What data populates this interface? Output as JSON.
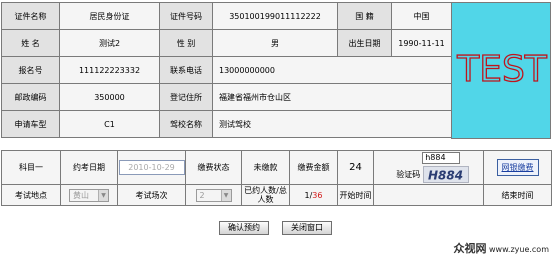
{
  "info": {
    "row1": {
      "id_label": "证件名称",
      "id_type": "居民身份证",
      "id_no_label": "证件号码",
      "id_no": "350100199011112222",
      "nationality_label": "国 籍",
      "nationality": "中国"
    },
    "row2": {
      "name_label": "姓 名",
      "name": "测试2",
      "gender_label": "性 别",
      "gender": "男",
      "birth_label": "出生日期",
      "birth": "1990-11-11"
    },
    "row3": {
      "reg_label": "报名号",
      "reg_no": "111122223332",
      "phone_label": "联系电话",
      "phone": "13000000000"
    },
    "row4": {
      "zip_label": "邮政编码",
      "zip": "350000",
      "addr_label": "登记住所",
      "addr": "福建省福州市仓山区"
    },
    "row5": {
      "cartype_label": "申请车型",
      "cartype": "C1",
      "school_label": "驾校名称",
      "school": "测试驾校"
    }
  },
  "photo": {
    "text": "TEST",
    "bg_color": "#51d6e8",
    "text_color": "#c0141c"
  },
  "exam": {
    "subject": "科目一",
    "date_label": "约考日期",
    "date_value": "2010-10-29",
    "pay_status_label": "缴费状态",
    "pay_status": "未缴款",
    "amount_label": "缴费金额",
    "amount": "24",
    "captcha_label": "验证码",
    "captcha_input": "h884",
    "captcha_image_text": "H884",
    "pay_button": "网银缴费",
    "place_label": "考试地点",
    "place_value": "黄山",
    "session_label": "考试场次",
    "session_value": "2",
    "booked_label": "已约人数/总人数",
    "booked_count": "1",
    "separator": "/",
    "total_count": "36",
    "start_label": "开始时间",
    "end_label": "结束时间"
  },
  "buttons": {
    "confirm": "确认预约",
    "close": "关闭窗口"
  },
  "footer": {
    "brand": "众视网",
    "url": "www.zyue.com"
  }
}
